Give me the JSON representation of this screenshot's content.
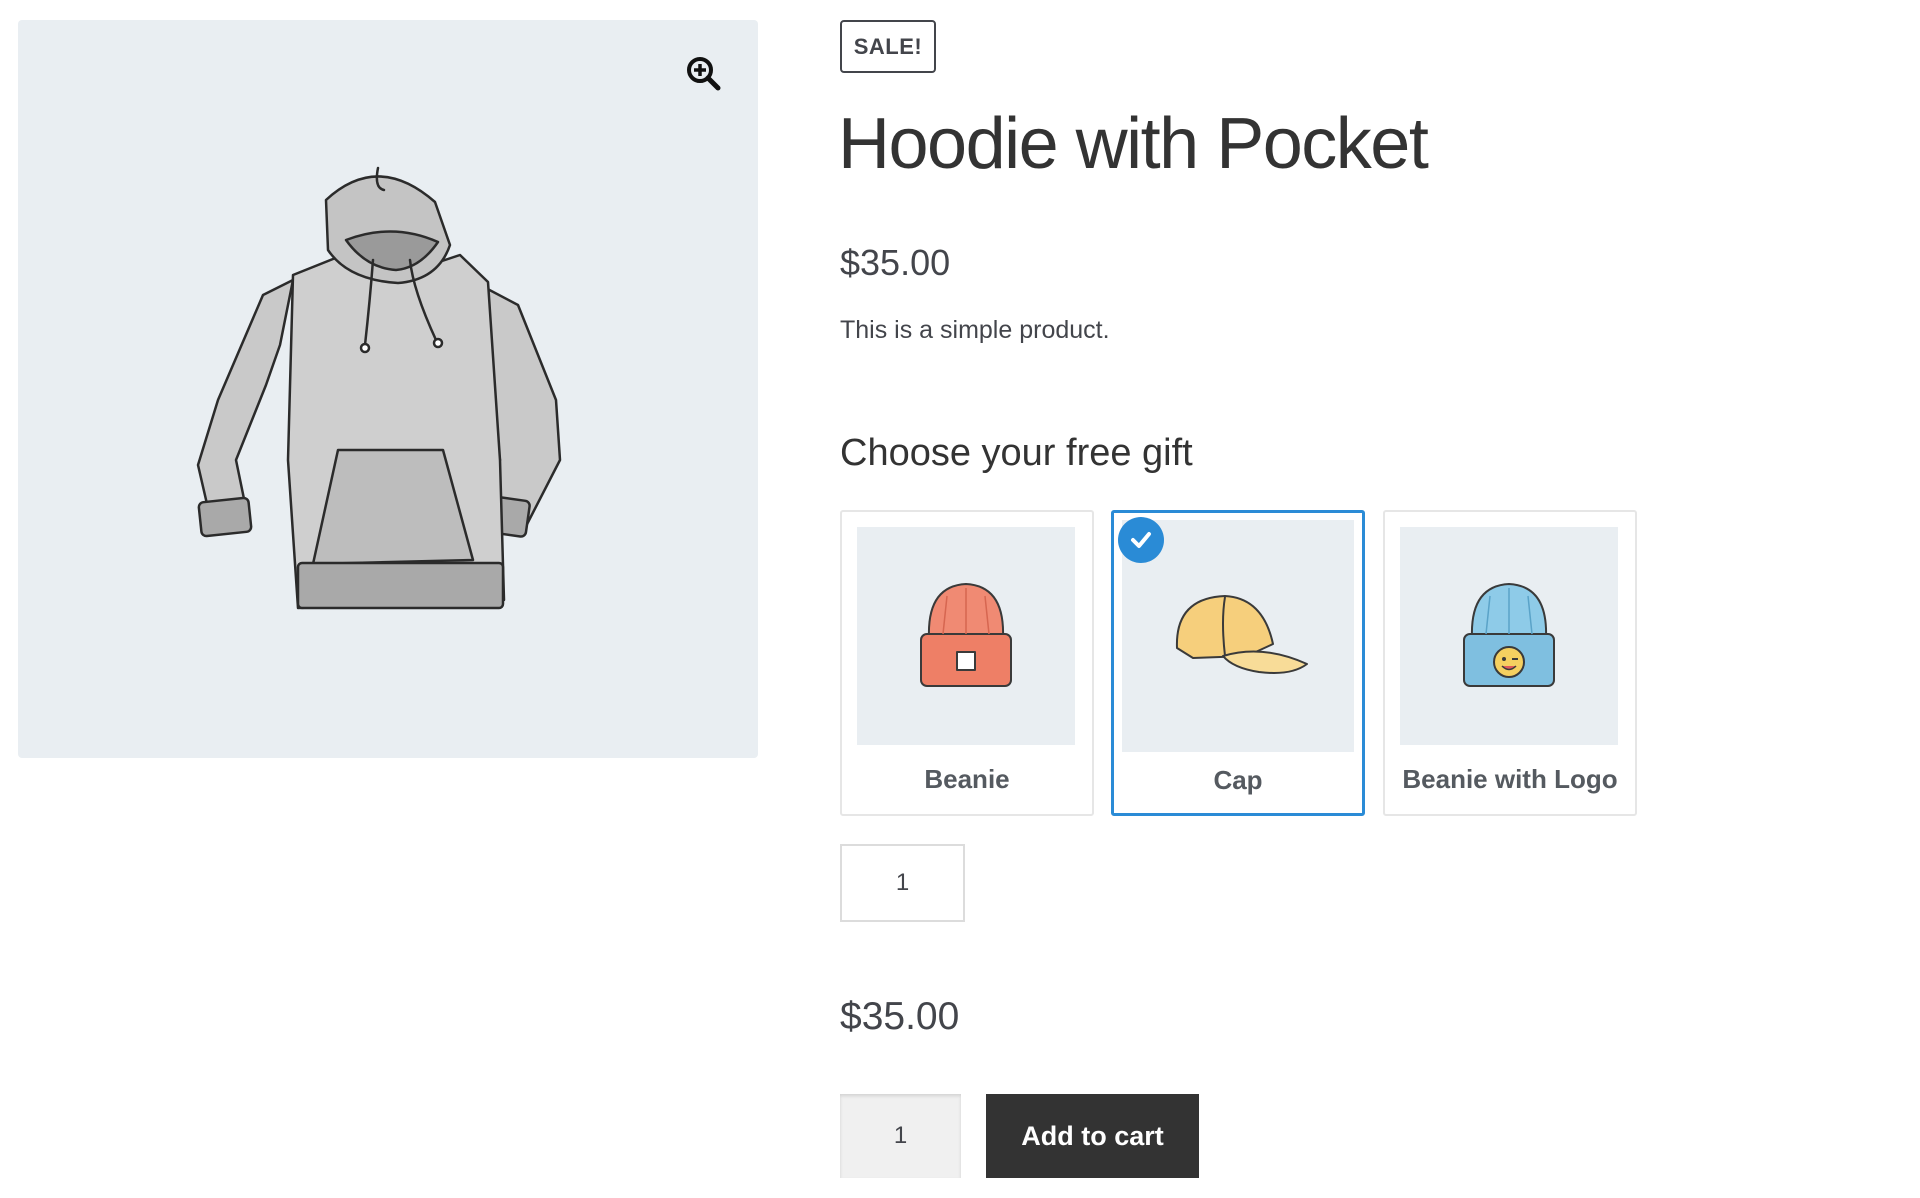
{
  "gallery": {
    "image": "hoodie-with-pocket-image",
    "zoom_icon": "magnify-plus-icon"
  },
  "product": {
    "badge": "SALE!",
    "title": "Hoodie with Pocket",
    "price": "$35.00",
    "description": "This is a simple product."
  },
  "gift": {
    "heading": "Choose your free gift",
    "options": [
      {
        "label": "Beanie",
        "selected": false,
        "color": "#f08a73"
      },
      {
        "label": "Cap",
        "selected": true,
        "color": "#f5d48a"
      },
      {
        "label": "Beanie with Logo",
        "selected": false,
        "color": "#8ecbe8"
      }
    ],
    "selected_icon": "checkmark-icon",
    "quantity": "1"
  },
  "cart": {
    "total_price": "$35.00",
    "quantity": "1",
    "button_label": "Add to cart"
  },
  "colors": {
    "accent": "#2a8bd6",
    "button": "#333333",
    "image_bg": "#e9eef2"
  }
}
